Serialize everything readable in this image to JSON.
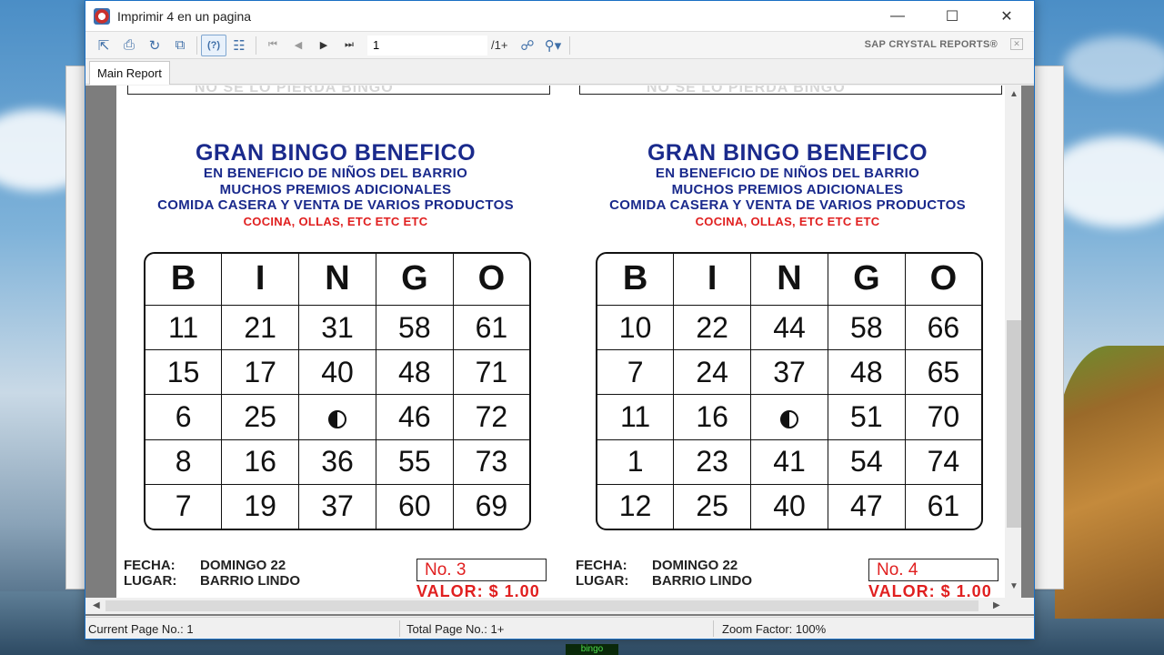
{
  "window": {
    "title": "Imprimir 4 en un pagina"
  },
  "toolbar": {
    "page_value": "1",
    "page_total": "/1+",
    "brand": "SAP CRYSTAL REPORTS®"
  },
  "tab": {
    "label": "Main Report"
  },
  "ghost_text": "NO SE LO PIERDA BINGO",
  "cards": [
    {
      "title": "GRAN BINGO BENEFICO",
      "line1": "EN BENEFICIO DE NIÑOS DEL BARRIO",
      "line2": "MUCHOS PREMIOS ADICIONALES",
      "line3": "COMIDA CASERA Y VENTA DE VARIOS PRODUCTOS",
      "line4": "COCINA, OLLAS, ETC ETC ETC",
      "header": [
        "B",
        "I",
        "N",
        "G",
        "O"
      ],
      "rows": [
        [
          "11",
          "21",
          "31",
          "58",
          "61"
        ],
        [
          "15",
          "17",
          "40",
          "48",
          "71"
        ],
        [
          "6",
          "25",
          "",
          "46",
          "72"
        ],
        [
          "8",
          "16",
          "36",
          "55",
          "73"
        ],
        [
          "7",
          "19",
          "37",
          "60",
          "69"
        ]
      ],
      "fecha_label": "FECHA:",
      "fecha": "DOMINGO 22",
      "lugar_label": "LUGAR:",
      "lugar": "BARRIO LINDO",
      "number": "No. 3",
      "valor": "VALOR: $ 1.00"
    },
    {
      "title": "GRAN BINGO BENEFICO",
      "line1": "EN BENEFICIO DE NIÑOS DEL BARRIO",
      "line2": "MUCHOS PREMIOS ADICIONALES",
      "line3": "COMIDA CASERA Y VENTA DE VARIOS PRODUCTOS",
      "line4": "COCINA, OLLAS, ETC ETC ETC",
      "header": [
        "B",
        "I",
        "N",
        "G",
        "O"
      ],
      "rows": [
        [
          "10",
          "22",
          "44",
          "58",
          "66"
        ],
        [
          "7",
          "24",
          "37",
          "48",
          "65"
        ],
        [
          "11",
          "16",
          "",
          "51",
          "70"
        ],
        [
          "1",
          "23",
          "41",
          "54",
          "74"
        ],
        [
          "12",
          "25",
          "40",
          "47",
          "61"
        ]
      ],
      "fecha_label": "FECHA:",
      "fecha": "DOMINGO 22",
      "lugar_label": "LUGAR:",
      "lugar": "BARRIO LINDO",
      "number": "No. 4",
      "valor": "VALOR: $ 1.00"
    }
  ],
  "status": {
    "current_page": "Current Page No.: 1",
    "total_page": "Total Page No.: 1+",
    "zoom": "Zoom Factor: 100%"
  },
  "taskbar_label": "bingo",
  "icons": {
    "export": "export-icon",
    "print": "print-icon",
    "refresh": "refresh-icon",
    "copy": "copy-icon",
    "help": "help-icon",
    "group_tree": "group-tree-icon",
    "first": "first-page-icon",
    "prev": "prev-page-icon",
    "next": "next-page-icon",
    "last": "last-page-icon",
    "find": "binoculars-icon",
    "zoom": "zoom-icon",
    "free_space": "yin-yang-icon"
  }
}
